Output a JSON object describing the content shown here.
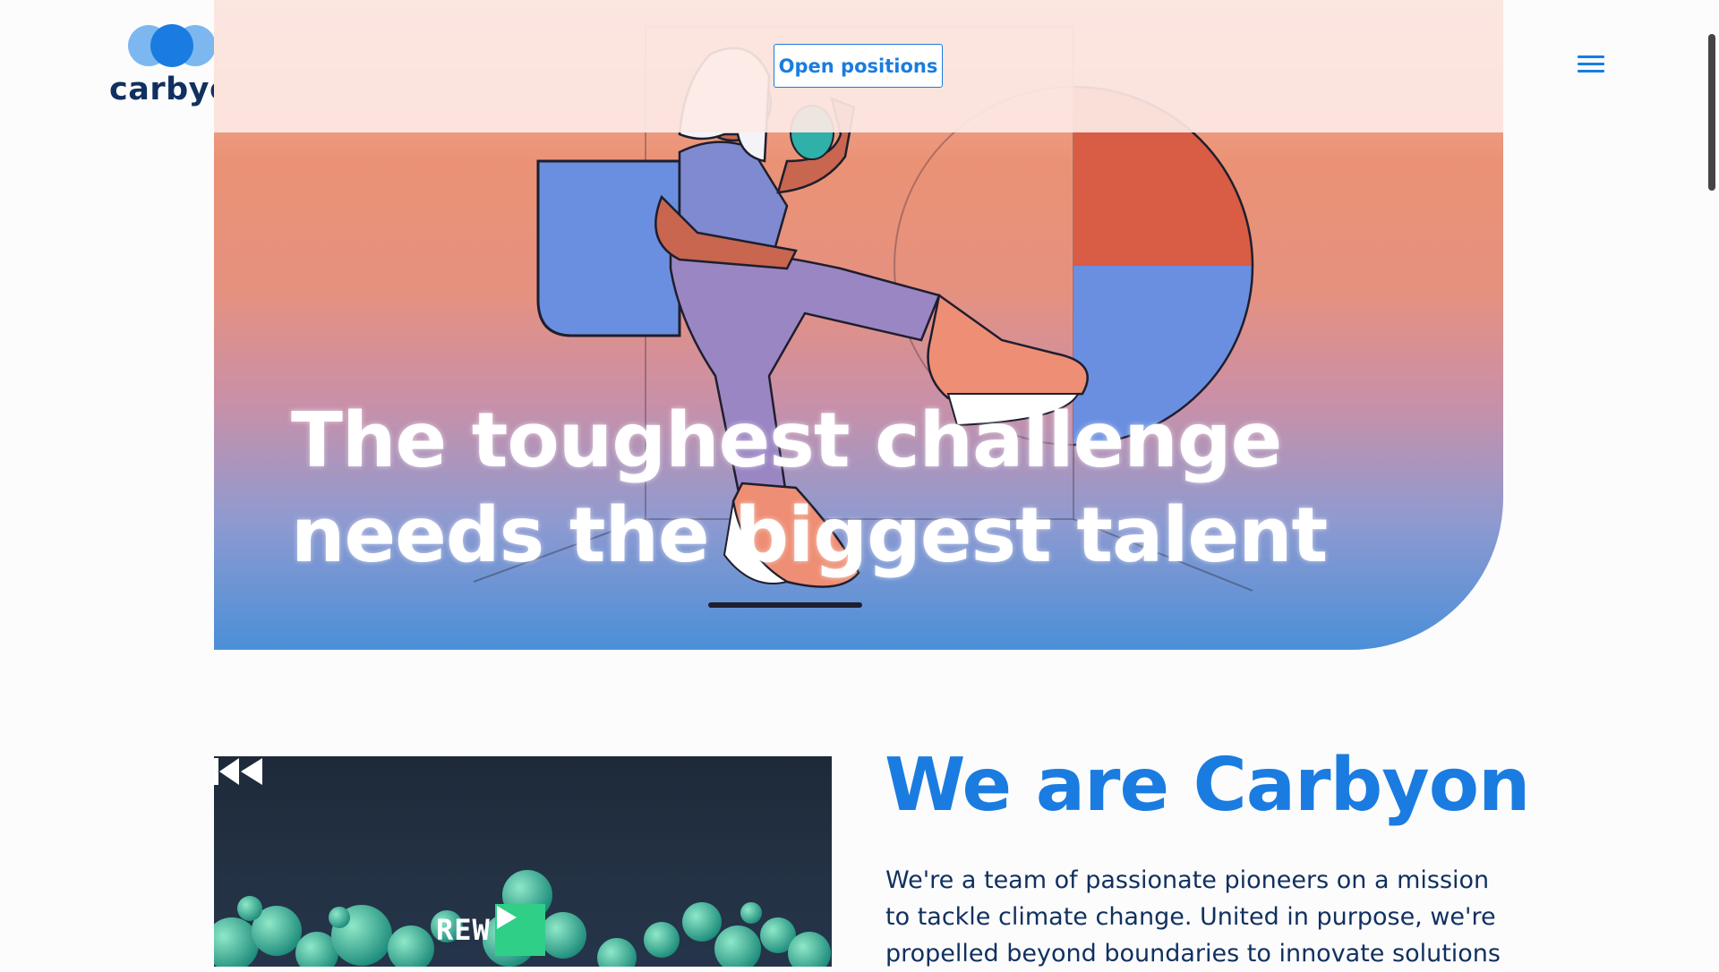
{
  "header": {
    "logo_text": "carbyon",
    "open_positions_label": "Open positions"
  },
  "hero": {
    "title_line1": "The toughest challenge",
    "title_line2": "needs the biggest talent"
  },
  "about": {
    "title": "We are Carbyon",
    "text": "We're a team of passionate pioneers on a mission to tackle climate change. United in purpose, we're propelled beyond boundaries to innovate solutions",
    "video": {
      "rew_label": "REW"
    }
  },
  "colors": {
    "accent": "#1a7ce0",
    "navy": "#10305f",
    "play_green": "#2fcf87"
  },
  "icons": [
    "carbyon-logo-icon",
    "menu-icon",
    "play-icon",
    "rewind-icon"
  ]
}
